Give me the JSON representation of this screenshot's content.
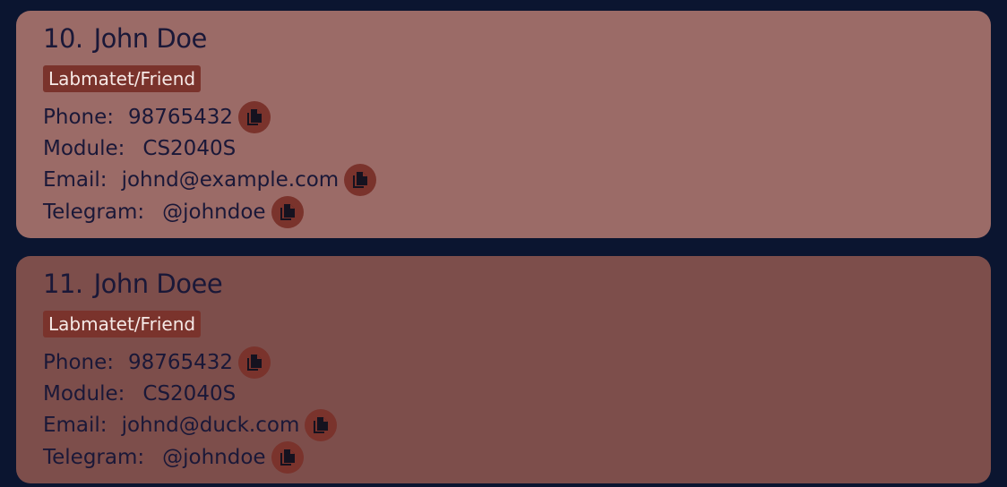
{
  "contacts": [
    {
      "index": "10.",
      "name": "John Doe",
      "tag": "Labmatet/Friend",
      "phone_label": "Phone:",
      "phone": "98765432",
      "module_label": "Module:",
      "module": "CS2040S",
      "email_label": "Email:",
      "email": "johnd@example.com",
      "telegram_label": "Telegram:",
      "telegram": "@johndoe"
    },
    {
      "index": "11.",
      "name": "John Doee",
      "tag": "Labmatet/Friend",
      "phone_label": "Phone:",
      "phone": "98765432",
      "module_label": "Module:",
      "module": "CS2040S",
      "email_label": "Email:",
      "email": "johnd@duck.com",
      "telegram_label": "Telegram:",
      "telegram": "@johndoe"
    }
  ],
  "colors": {
    "background": "#0b1530",
    "card_selected": "#9b6b67",
    "card_default": "#7d4e4b",
    "accent": "#7a332c",
    "text": "#1a1838"
  },
  "icons": {
    "copy": "copy-icon"
  }
}
